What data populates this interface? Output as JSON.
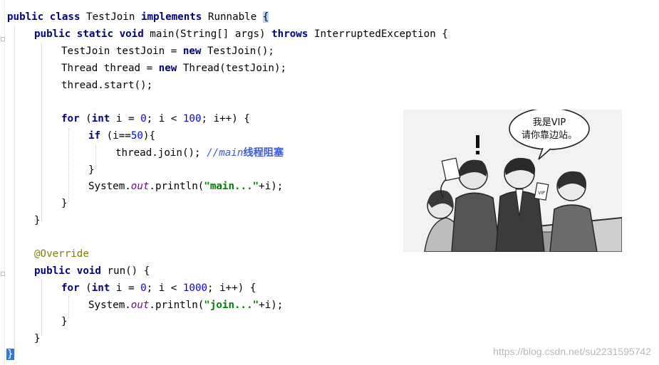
{
  "code": {
    "line1": {
      "kw1": "public class",
      "name": "TestJoin",
      "kw2": "implements",
      "iface": "Runnable",
      "brace": "{"
    },
    "line2": {
      "kw1": "public static void",
      "sig": "main(String[] args)",
      "kw2": "throws",
      "exc": "InterruptedException {"
    },
    "line3": {
      "text1": "TestJoin testJoin = ",
      "kw": "new",
      "text2": "TestJoin();"
    },
    "line4": {
      "text1": "Thread thread = ",
      "kw": "new",
      "text2": "Thread(testJoin);"
    },
    "line5": {
      "text": "thread.start();"
    },
    "line7": {
      "kw1": "for",
      "p1": " (",
      "kw2": "int",
      "p2": " i = ",
      "n1": "0",
      "p3": "; i < ",
      "n2": "100",
      "p4": "; i++) {"
    },
    "line8": {
      "kw": "if",
      "p1": " (i==",
      "n": "50",
      "p2": "){"
    },
    "line9": {
      "text": "thread.join(); ",
      "cmt": "//main",
      "cmt_cn": "线程阻塞"
    },
    "line10": {
      "text": "}"
    },
    "line11": {
      "p1": "System.",
      "field": "out",
      "p2": ".println(",
      "str": "\"main...\"",
      "p3": "+i);"
    },
    "line12": {
      "text": "}"
    },
    "line13": {
      "text": "}"
    },
    "line15": {
      "anno": "@Override"
    },
    "line16": {
      "kw": "public void",
      "text": " run() {"
    },
    "line17": {
      "kw1": "for",
      "p1": " (",
      "kw2": "int",
      "p2": " i = ",
      "n1": "0",
      "p3": "; i < ",
      "n2": "1000",
      "p4": "; i++) {"
    },
    "line18": {
      "p1": "System.",
      "field": "out",
      "p2": ".println(",
      "str": "\"join...\"",
      "p3": "+i);"
    },
    "line19": {
      "text": "}"
    },
    "line20": {
      "text": "}"
    },
    "line21": {
      "brace": "}"
    }
  },
  "comic": {
    "bubble_line1": "我是VIP",
    "bubble_line2": "请你靠边站。",
    "card_label": "VIP",
    "exclaim": "!"
  },
  "watermark": "https://blog.csdn.net/su2231595742"
}
